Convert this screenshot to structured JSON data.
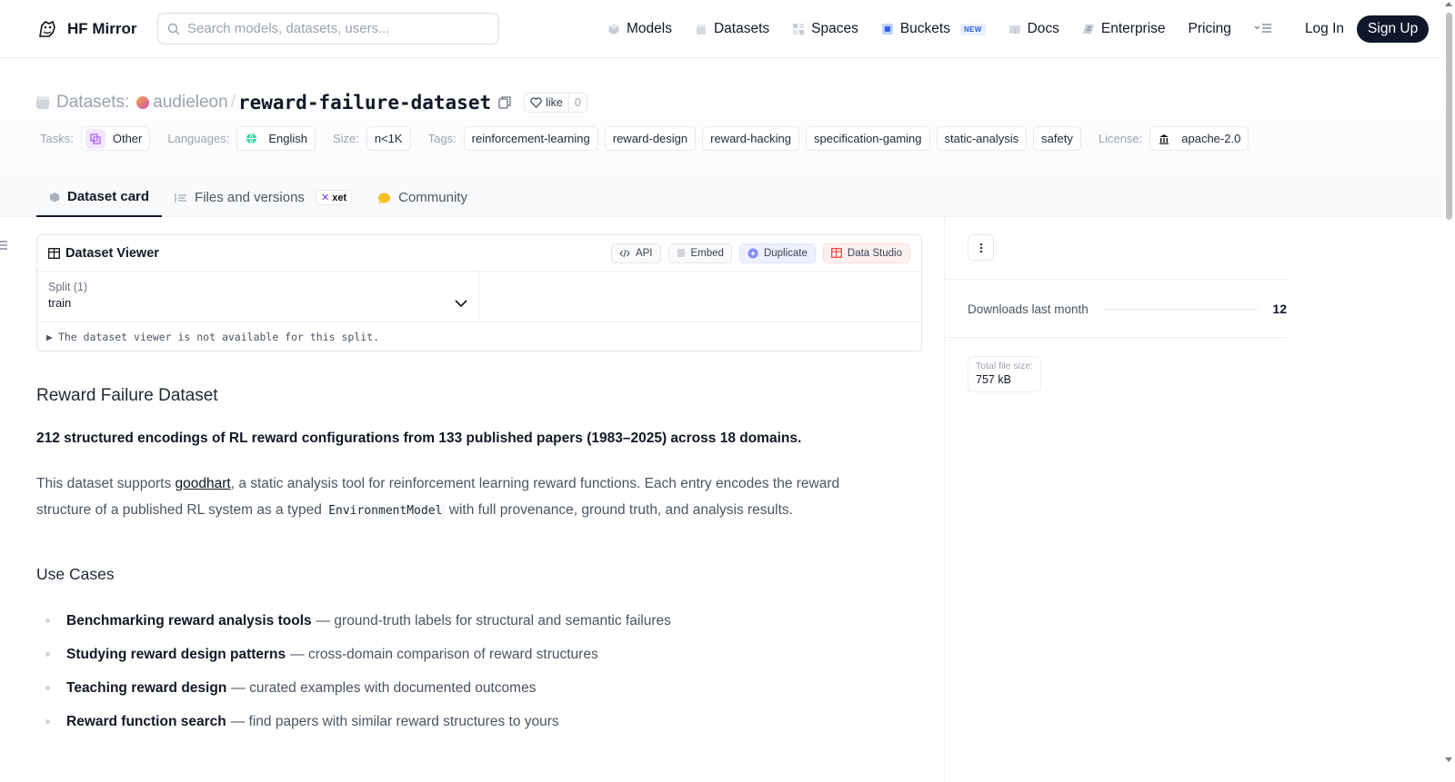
{
  "nav": {
    "brand": "HF Mirror",
    "search_placeholder": "Search models, datasets, users...",
    "links": [
      {
        "label": "Models",
        "icon": "models-icon"
      },
      {
        "label": "Datasets",
        "icon": "datasets-icon"
      },
      {
        "label": "Spaces",
        "icon": "spaces-icon"
      },
      {
        "label": "Buckets",
        "icon": "buckets-icon",
        "badge": "NEW"
      },
      {
        "label": "Docs",
        "icon": "docs-icon"
      },
      {
        "label": "Enterprise",
        "icon": "enterprise-icon"
      },
      {
        "label": "Pricing"
      }
    ],
    "login": "Log In",
    "signup": "Sign Up"
  },
  "header": {
    "label": "Datasets:",
    "owner": "audieleon",
    "slash": "/",
    "name": "reward-failure-dataset",
    "like_label": "like",
    "like_count": "0"
  },
  "tags": {
    "tasks_label": "Tasks:",
    "task": "Other",
    "languages_label": "Languages:",
    "language": "English",
    "size_label": "Size:",
    "size": "n<1K",
    "tags_label": "Tags:",
    "items": [
      "reinforcement-learning",
      "reward-design",
      "reward-hacking",
      "specification-gaming",
      "static-analysis",
      "safety"
    ],
    "license_label": "License:",
    "license": "apache-2.0"
  },
  "tabs": [
    {
      "label": "Dataset card",
      "active": true
    },
    {
      "label": "Files and versions",
      "badge": "xet"
    },
    {
      "label": "Community"
    }
  ],
  "viewer": {
    "title": "Dataset Viewer",
    "buttons": {
      "api": "API",
      "embed": "Embed",
      "duplicate": "Duplicate",
      "data_studio": "Data Studio"
    },
    "split_label": "Split (1)",
    "split_value": "train",
    "note": "The dataset viewer is not available for this split."
  },
  "card": {
    "title": "Reward Failure Dataset",
    "lead": "212 structured encodings of RL reward configurations from 133 published papers (1983–2025) across 18 domains.",
    "body_1": "This dataset supports ",
    "body_link": "goodhart",
    "body_2": ", a static analysis tool for reinforcement learning reward functions. Each entry encodes the reward structure of a published RL system as a typed ",
    "body_code": "EnvironmentModel",
    "body_3": " with full provenance, ground truth, and analysis results.",
    "use_cases_title": "Use Cases",
    "use_cases": [
      {
        "term": "Benchmarking reward analysis tools",
        "desc": "— ground-truth labels for structural and semantic failures"
      },
      {
        "term": "Studying reward design patterns",
        "desc": "— cross-domain comparison of reward structures"
      },
      {
        "term": "Teaching reward design",
        "desc": "— curated examples with documented outcomes"
      },
      {
        "term": "Reward function search",
        "desc": "— find papers with similar reward structures to yours"
      }
    ]
  },
  "sidebar": {
    "downloads_label": "Downloads last month",
    "downloads_value": "12",
    "file_size_label": "Total file size:",
    "file_size_value": "757 kB"
  }
}
